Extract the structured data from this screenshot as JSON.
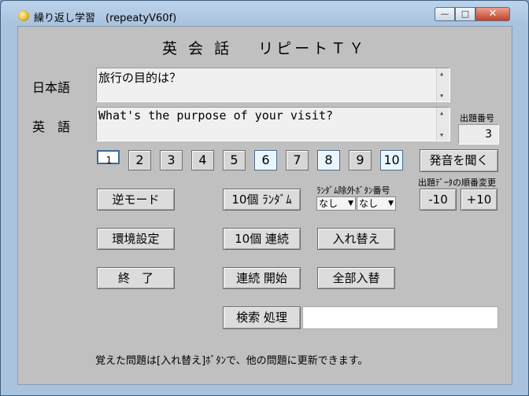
{
  "window": {
    "title": "繰り返し学習　(repeatyV60f)",
    "minimize": "—",
    "maximize": "□",
    "close": "✕"
  },
  "heading": "英 会 話　 リピートＴＹ",
  "labels": {
    "japanese": "日本語",
    "english": "英　語"
  },
  "fields": {
    "japanese_text": "旅行の目的は？",
    "english_text": "What's the purpose of your visit?"
  },
  "question_number": {
    "label": "出題番号",
    "value": "3"
  },
  "number_buttons": [
    "1",
    "2",
    "3",
    "4",
    "5",
    "6",
    "7",
    "8",
    "9",
    "10"
  ],
  "buttons": {
    "pronounce": "発音を聞く",
    "reverse_mode": "逆モード",
    "ten_random": "10個 ﾗﾝﾀﾞﾑ",
    "settings": "環境設定",
    "ten_sequential": "10個 連続",
    "swap": "入れ替え",
    "exit": "終　了",
    "start_continuous": "連続 開始",
    "swap_all": "全部入替",
    "search": "検索 処理",
    "minus10": "-10",
    "plus10": "+10"
  },
  "random_exclude": {
    "label": "ﾗﾝﾀﾞﾑ除外ﾎﾞﾀﾝ番号",
    "select1": "なし",
    "select2": "なし"
  },
  "order_change_label": "出題ﾃﾞｰﾀの順番変更",
  "footer": "覚えた問題は[入れ替え]ﾎﾞﾀﾝで、他の問題に更新できます。"
}
